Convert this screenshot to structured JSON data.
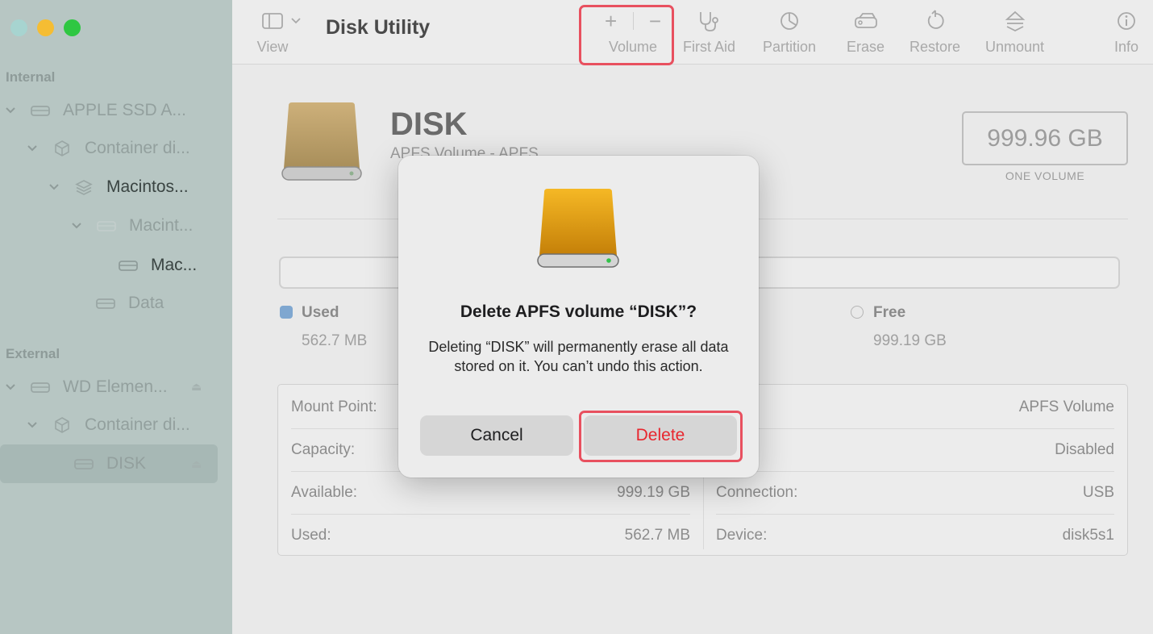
{
  "window": {
    "title": "Disk Utility"
  },
  "sidebar": {
    "sections": {
      "internal": "Internal",
      "external": "External"
    },
    "items": [
      {
        "label": "APPLE SSD A...",
        "icon": "disk-icon"
      },
      {
        "label": "Container di...",
        "icon": "container-icon"
      },
      {
        "label": "Macintos...",
        "icon": "layers-icon"
      },
      {
        "label": "Macint...",
        "icon": "disk-icon"
      },
      {
        "label": "Mac...",
        "icon": "disk-icon"
      },
      {
        "label": "Data",
        "icon": "disk-icon"
      },
      {
        "label": "WD Elemen...",
        "icon": "disk-icon"
      },
      {
        "label": "Container di...",
        "icon": "container-icon"
      },
      {
        "label": "DISK",
        "icon": "disk-icon",
        "selected": true
      }
    ]
  },
  "toolbar": {
    "view_label": "View",
    "volume_label": "Volume",
    "first_aid_label": "First Aid",
    "partition_label": "Partition",
    "erase_label": "Erase",
    "restore_label": "Restore",
    "unmount_label": "Unmount",
    "info_label": "Info",
    "add_symbol": "+",
    "remove_symbol": "−"
  },
  "volume": {
    "name": "DISK",
    "subtitle": "APFS Volume - APFS",
    "capacity": "999.96 GB",
    "capacity_label": "ONE VOLUME"
  },
  "usage": {
    "used_label": "Used",
    "used_value": "562.7 MB",
    "free_label": "Free",
    "free_value": "999.19 GB",
    "used_color": "#7fa7d0"
  },
  "info": {
    "left": [
      {
        "key": "Mount Point:",
        "value": ""
      },
      {
        "key": "Capacity:",
        "value": ""
      },
      {
        "key": "Available:",
        "value": "999.19 GB"
      },
      {
        "key": "Used:",
        "value": "562.7 MB"
      }
    ],
    "right": [
      {
        "key": "",
        "value": "APFS Volume"
      },
      {
        "key": "rs:",
        "value": "Disabled"
      },
      {
        "key": "Connection:",
        "value": "USB"
      },
      {
        "key": "Device:",
        "value": "disk5s1"
      }
    ]
  },
  "dialog": {
    "title": "Delete APFS volume “DISK”?",
    "message": "Deleting “DISK” will permanently erase all data stored on it. You can’t undo this action.",
    "cancel_label": "Cancel",
    "delete_label": "Delete",
    "delete_color": "#e8262e"
  },
  "highlight_color": "#e8505f"
}
